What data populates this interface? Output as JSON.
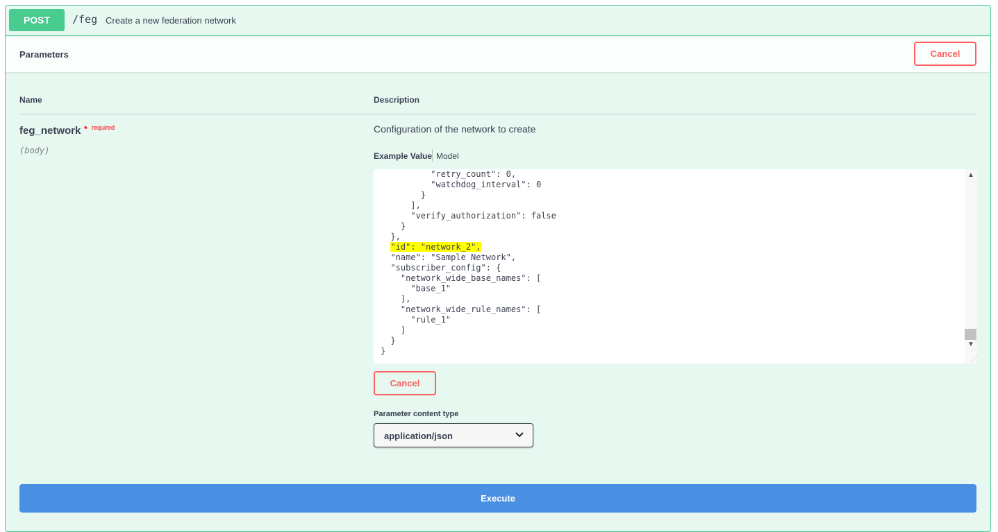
{
  "operation": {
    "method": "POST",
    "path": "/feg",
    "summary": "Create a new federation network"
  },
  "parameters_section": {
    "title": "Parameters",
    "cancel_label": "Cancel"
  },
  "table": {
    "name_header": "Name",
    "description_header": "Description"
  },
  "parameter": {
    "name": "feg_network",
    "required_star": "*",
    "required_label": "required",
    "location": "(body)",
    "description": "Configuration of the network to create"
  },
  "tabs": {
    "example_value": "Example Value",
    "model": "Model"
  },
  "code_lines": [
    "          \"retry_count\": 0,",
    "          \"watchdog_interval\": 0",
    "        }",
    "      ],",
    "      \"verify_authorization\": false",
    "    }",
    "  },",
    "  \"id\": \"network_2\",",
    "  \"name\": \"Sample Network\",",
    "  \"subscriber_config\": {",
    "    \"network_wide_base_names\": [",
    "      \"base_1\"",
    "    ],",
    "    \"network_wide_rule_names\": [",
    "      \"rule_1\"",
    "    ]",
    "  }",
    "}"
  ],
  "highlighted_line_index": 7,
  "body_cancel_label": "Cancel",
  "content_type": {
    "label": "Parameter content type",
    "selected": "application/json"
  },
  "execute_label": "Execute",
  "colors": {
    "post_green": "#49cc90",
    "cancel_red": "#ff6060",
    "execute_blue": "#4990e2",
    "highlight_yellow": "#ffff00"
  }
}
